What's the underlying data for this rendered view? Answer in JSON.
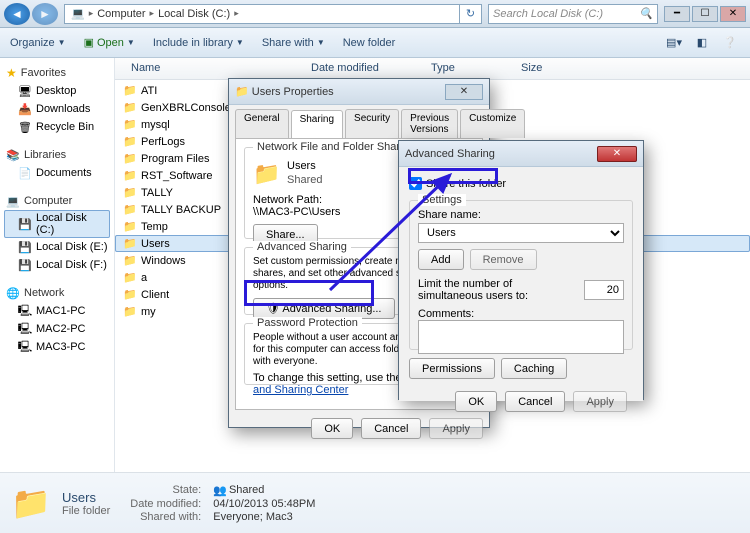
{
  "path": {
    "computer": "Computer",
    "drive": "Local Disk (C:)",
    "search_ph": "Search Local Disk (C:)"
  },
  "toolbar": {
    "organize": "Organize",
    "open": "Open",
    "include": "Include in library",
    "share": "Share with",
    "newfolder": "New folder"
  },
  "nav": {
    "favorites": "Favorites",
    "desktop": "Desktop",
    "downloads": "Downloads",
    "recycle": "Recycle Bin",
    "libraries": "Libraries",
    "documents": "Documents",
    "computer": "Computer",
    "drive_c": "Local Disk (C:)",
    "drive_e": "Local Disk (E:)",
    "drive_f": "Local Disk (F:)",
    "network": "Network",
    "mac1": "MAC1-PC",
    "mac2": "MAC2-PC",
    "mac3": "MAC3-PC"
  },
  "cols": {
    "name": "Name",
    "date": "Date modified",
    "type": "Type",
    "size": "Size"
  },
  "files": [
    "ATI",
    "GenXBRLConsole",
    "mysql",
    "PerfLogs",
    "Program Files",
    "RST_Software",
    "TALLY",
    "TALLY  BACKUP",
    "Temp",
    "Users",
    "Windows",
    "a",
    "Client",
    "my"
  ],
  "details": {
    "name": "Users",
    "type": "File folder",
    "state_lbl": "State:",
    "state_val": "Shared",
    "mod_lbl": "Date modified:",
    "mod_val": "04/10/2013 05:48PM",
    "shared_lbl": "Shared with:",
    "shared_val": "Everyone; Mac3"
  },
  "props": {
    "title": "Users Properties",
    "tabs": {
      "general": "General",
      "sharing": "Sharing",
      "security": "Security",
      "prev": "Previous Versions",
      "customize": "Customize"
    },
    "nfs_group": "Network File and Folder Sharing",
    "folder": "Users",
    "status": "Shared",
    "netpath_lbl": "Network Path:",
    "netpath": "\\\\MAC3-PC\\Users",
    "share_btn": "Share...",
    "adv_group": "Advanced Sharing",
    "adv_desc": "Set custom permissions, create multiple shares, and set other advanced sharing options.",
    "adv_btn": "Advanced Sharing...",
    "pwd_group": "Password Protection",
    "pwd_desc": "People without a user account and password for this computer can access folders shared with everyone.",
    "pwd_link_pre": "To change this setting, use the ",
    "pwd_link": "Network and Sharing Center",
    "ok": "OK",
    "cancel": "Cancel",
    "apply": "Apply"
  },
  "adv": {
    "title": "Advanced Sharing",
    "share_this": "Share this folder",
    "settings": "Settings",
    "sharename_lbl": "Share name:",
    "sharename": "Users",
    "add": "Add",
    "remove": "Remove",
    "limit_lbl": "Limit the number of simultaneous users to:",
    "limit_val": "20",
    "comments_lbl": "Comments:",
    "permissions": "Permissions",
    "caching": "Caching",
    "ok": "OK",
    "cancel": "Cancel",
    "apply": "Apply"
  }
}
